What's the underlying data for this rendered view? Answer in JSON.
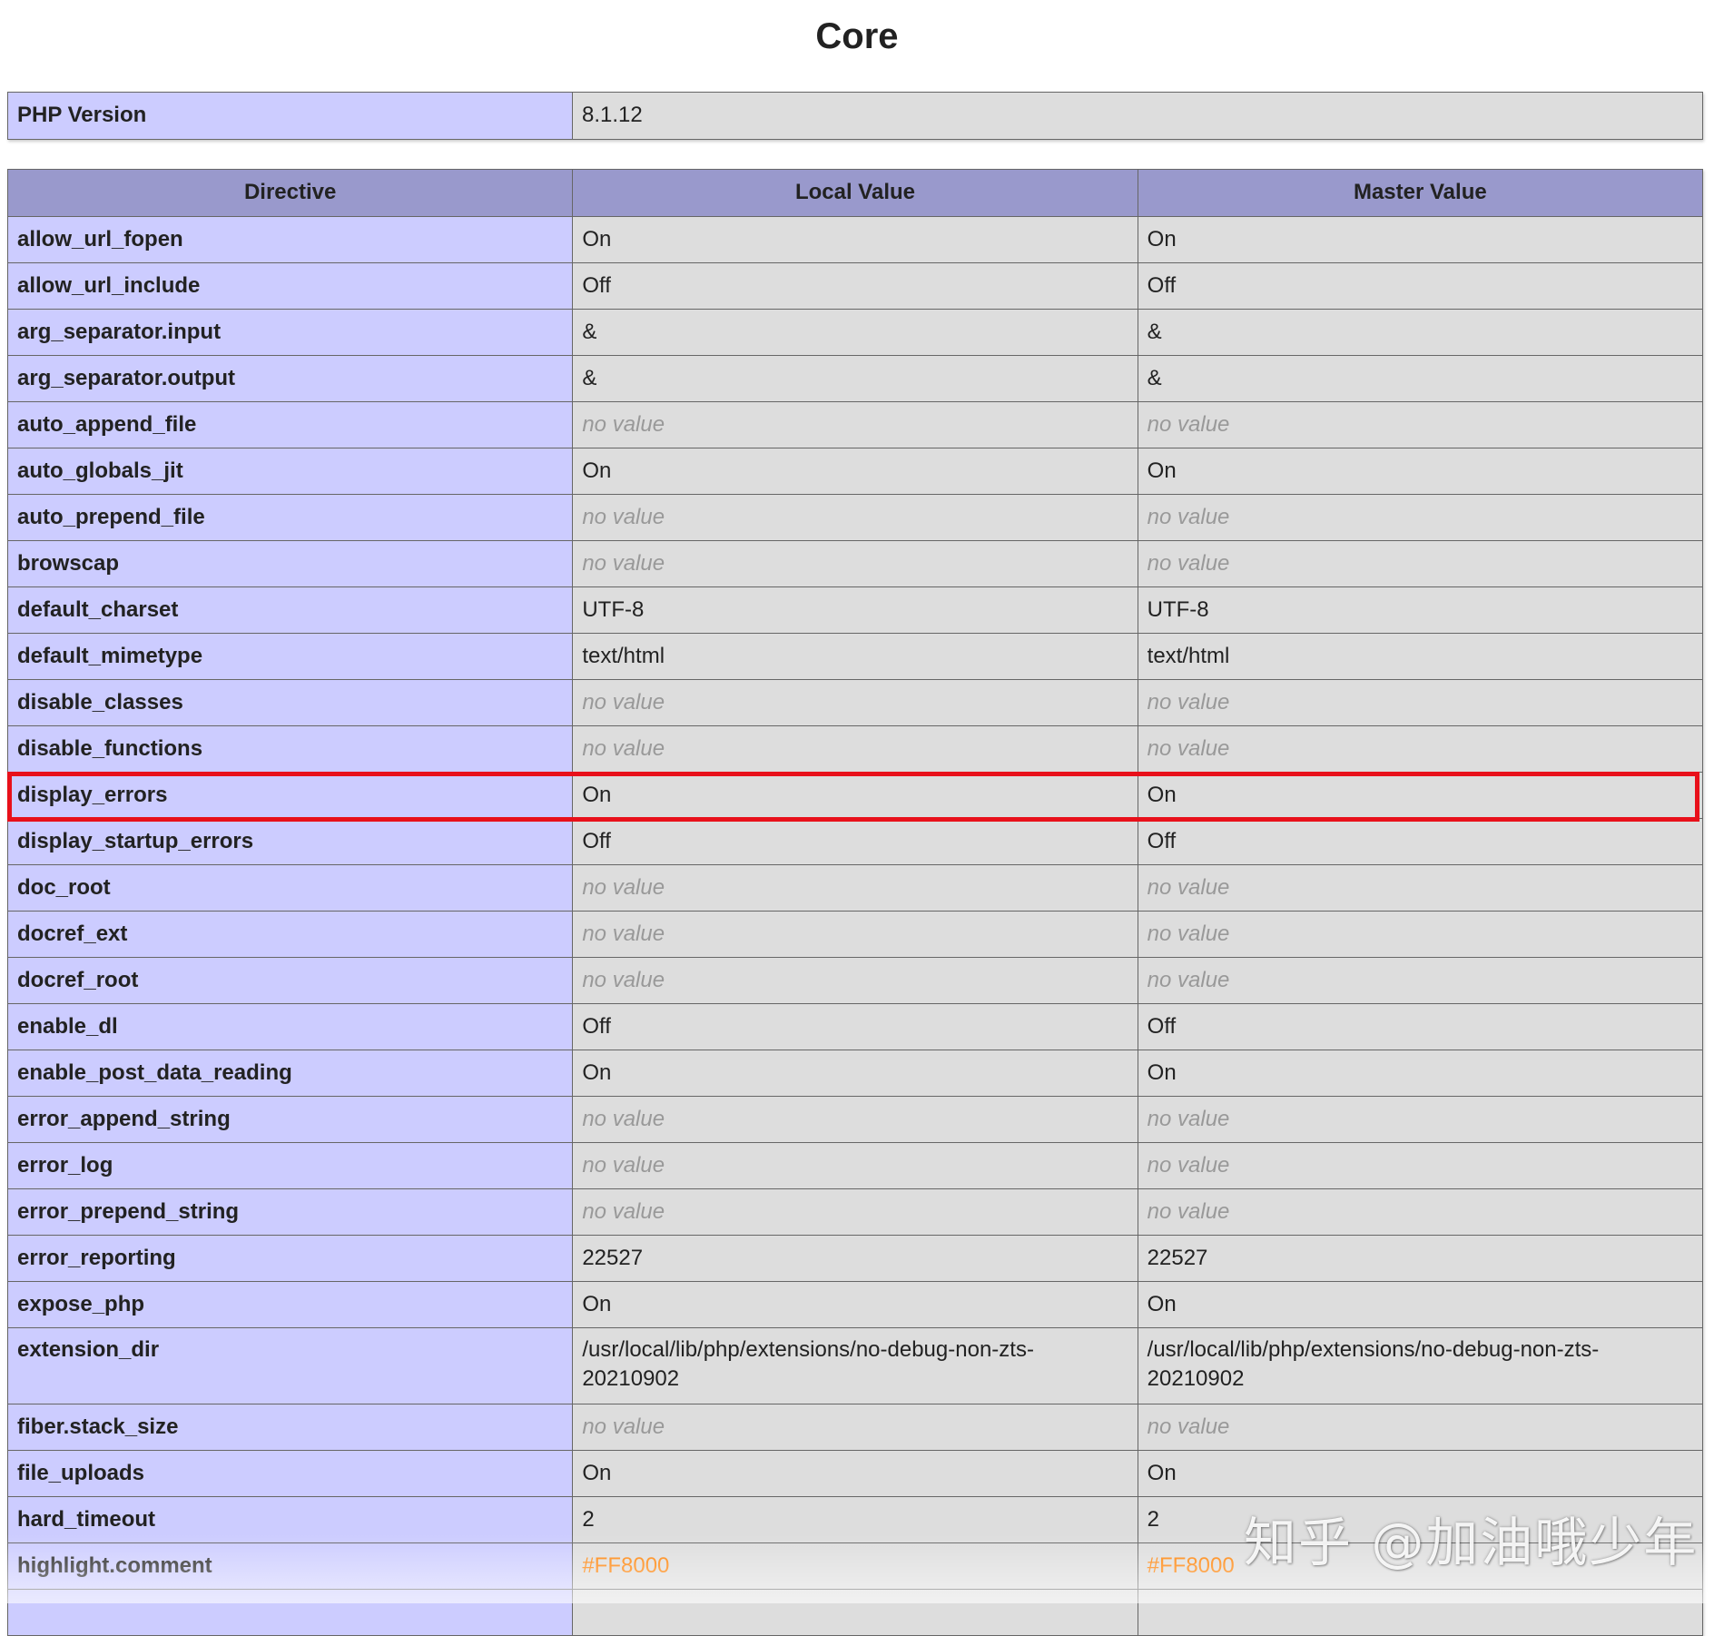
{
  "section_title": "Core",
  "version_row": {
    "label": "PHP Version",
    "value": "8.1.12"
  },
  "columns": [
    "Directive",
    "Local Value",
    "Master Value"
  ],
  "rows": [
    {
      "name": "allow_url_fopen",
      "local": "On",
      "master": "On"
    },
    {
      "name": "allow_url_include",
      "local": "Off",
      "master": "Off"
    },
    {
      "name": "arg_separator.input",
      "local": "&",
      "master": "&"
    },
    {
      "name": "arg_separator.output",
      "local": "&",
      "master": "&"
    },
    {
      "name": "auto_append_file",
      "local": "no value",
      "master": "no value",
      "empty": true
    },
    {
      "name": "auto_globals_jit",
      "local": "On",
      "master": "On"
    },
    {
      "name": "auto_prepend_file",
      "local": "no value",
      "master": "no value",
      "empty": true
    },
    {
      "name": "browscap",
      "local": "no value",
      "master": "no value",
      "empty": true
    },
    {
      "name": "default_charset",
      "local": "UTF-8",
      "master": "UTF-8"
    },
    {
      "name": "default_mimetype",
      "local": "text/html",
      "master": "text/html"
    },
    {
      "name": "disable_classes",
      "local": "no value",
      "master": "no value",
      "empty": true
    },
    {
      "name": "disable_functions",
      "local": "no value",
      "master": "no value",
      "empty": true
    },
    {
      "name": "display_errors",
      "local": "On",
      "master": "On",
      "highlighted": true
    },
    {
      "name": "display_startup_errors",
      "local": "Off",
      "master": "Off"
    },
    {
      "name": "doc_root",
      "local": "no value",
      "master": "no value",
      "empty": true
    },
    {
      "name": "docref_ext",
      "local": "no value",
      "master": "no value",
      "empty": true
    },
    {
      "name": "docref_root",
      "local": "no value",
      "master": "no value",
      "empty": true
    },
    {
      "name": "enable_dl",
      "local": "Off",
      "master": "Off"
    },
    {
      "name": "enable_post_data_reading",
      "local": "On",
      "master": "On"
    },
    {
      "name": "error_append_string",
      "local": "no value",
      "master": "no value",
      "empty": true
    },
    {
      "name": "error_log",
      "local": "no value",
      "master": "no value",
      "empty": true
    },
    {
      "name": "error_prepend_string",
      "local": "no value",
      "master": "no value",
      "empty": true
    },
    {
      "name": "error_reporting",
      "local": "22527",
      "master": "22527"
    },
    {
      "name": "expose_php",
      "local": "On",
      "master": "On"
    },
    {
      "name": "extension_dir",
      "local": "/usr/local/lib/php/extensions/no-debug-non-zts-20210902",
      "master": "/usr/local/lib/php/extensions/no-debug-non-zts-20210902",
      "tall": true
    },
    {
      "name": "fiber.stack_size",
      "local": "no value",
      "master": "no value",
      "empty": true
    },
    {
      "name": "file_uploads",
      "local": "On",
      "master": "On"
    },
    {
      "name": "hard_timeout",
      "local": "2",
      "master": "2"
    },
    {
      "name": "highlight.comment",
      "local": "#FF8000",
      "master": "#FF8000",
      "color": "#FF8000"
    },
    {
      "name": "",
      "local": "",
      "master": ""
    }
  ],
  "watermark": "知乎 @加油哦少年",
  "highlight_color": "#E8101A"
}
